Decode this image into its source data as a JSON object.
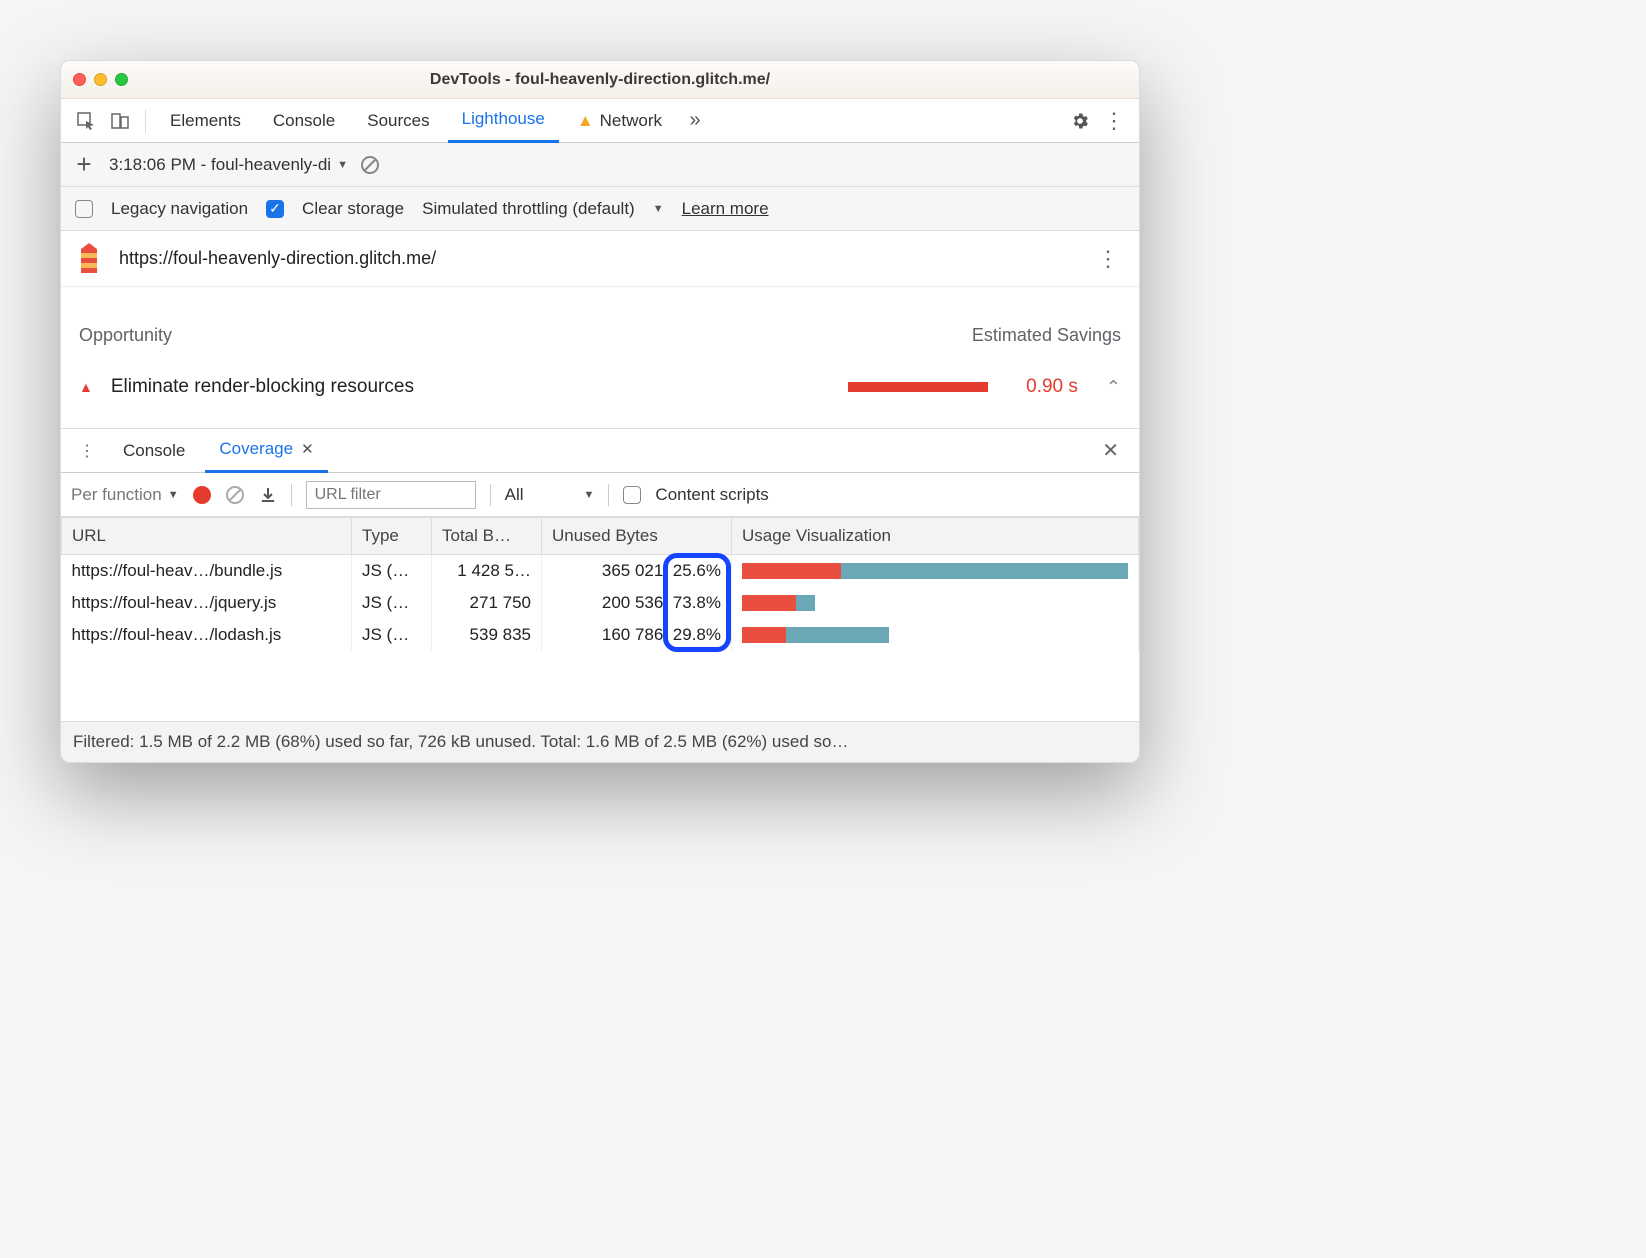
{
  "window": {
    "title": "DevTools - foul-heavenly-direction.glitch.me/"
  },
  "tabs": {
    "items": [
      "Elements",
      "Console",
      "Sources",
      "Lighthouse",
      "Network"
    ],
    "active": "Lighthouse",
    "network_warning": true
  },
  "runbar": {
    "label": "3:18:06 PM - foul-heavenly-di"
  },
  "options": {
    "legacy_label": "Legacy navigation",
    "legacy_checked": false,
    "clear_label": "Clear storage",
    "clear_checked": true,
    "throttling_label": "Simulated throttling (default)",
    "learn_more": "Learn more"
  },
  "audit": {
    "url": "https://foul-heavenly-direction.glitch.me/",
    "col_opportunity": "Opportunity",
    "col_savings": "Estimated Savings",
    "item_label": "Eliminate render-blocking resources",
    "item_savings": "0.90 s"
  },
  "drawer": {
    "tabs": {
      "console": "Console",
      "coverage": "Coverage"
    },
    "active": "Coverage"
  },
  "coverage": {
    "mode": "Per function",
    "filter_placeholder": "URL filter",
    "type_filter": "All",
    "content_scripts_label": "Content scripts",
    "content_scripts_checked": false,
    "columns": {
      "url": "URL",
      "type": "Type",
      "total": "Total B…",
      "unused": "Unused Bytes",
      "viz": "Usage Visualization"
    },
    "rows": [
      {
        "url": "https://foul-heav…/bundle.js",
        "type": "JS (…",
        "total": "1 428 5…",
        "unused_bytes": "365 021",
        "unused_pct": "25.6%",
        "unused_frac": 0.256
      },
      {
        "url": "https://foul-heav…/jquery.js",
        "type": "JS (…",
        "total": "271 750",
        "unused_bytes": "200 536",
        "unused_pct": "73.8%",
        "unused_frac": 0.738,
        "width_frac": 0.19
      },
      {
        "url": "https://foul-heav…/lodash.js",
        "type": "JS (…",
        "total": "539 835",
        "unused_bytes": "160 786",
        "unused_pct": "29.8%",
        "unused_frac": 0.298,
        "width_frac": 0.38
      }
    ],
    "footer": "Filtered: 1.5 MB of 2.2 MB (68%) used so far, 726 kB unused. Total: 1.6 MB of 2.5 MB (62%) used so…"
  }
}
